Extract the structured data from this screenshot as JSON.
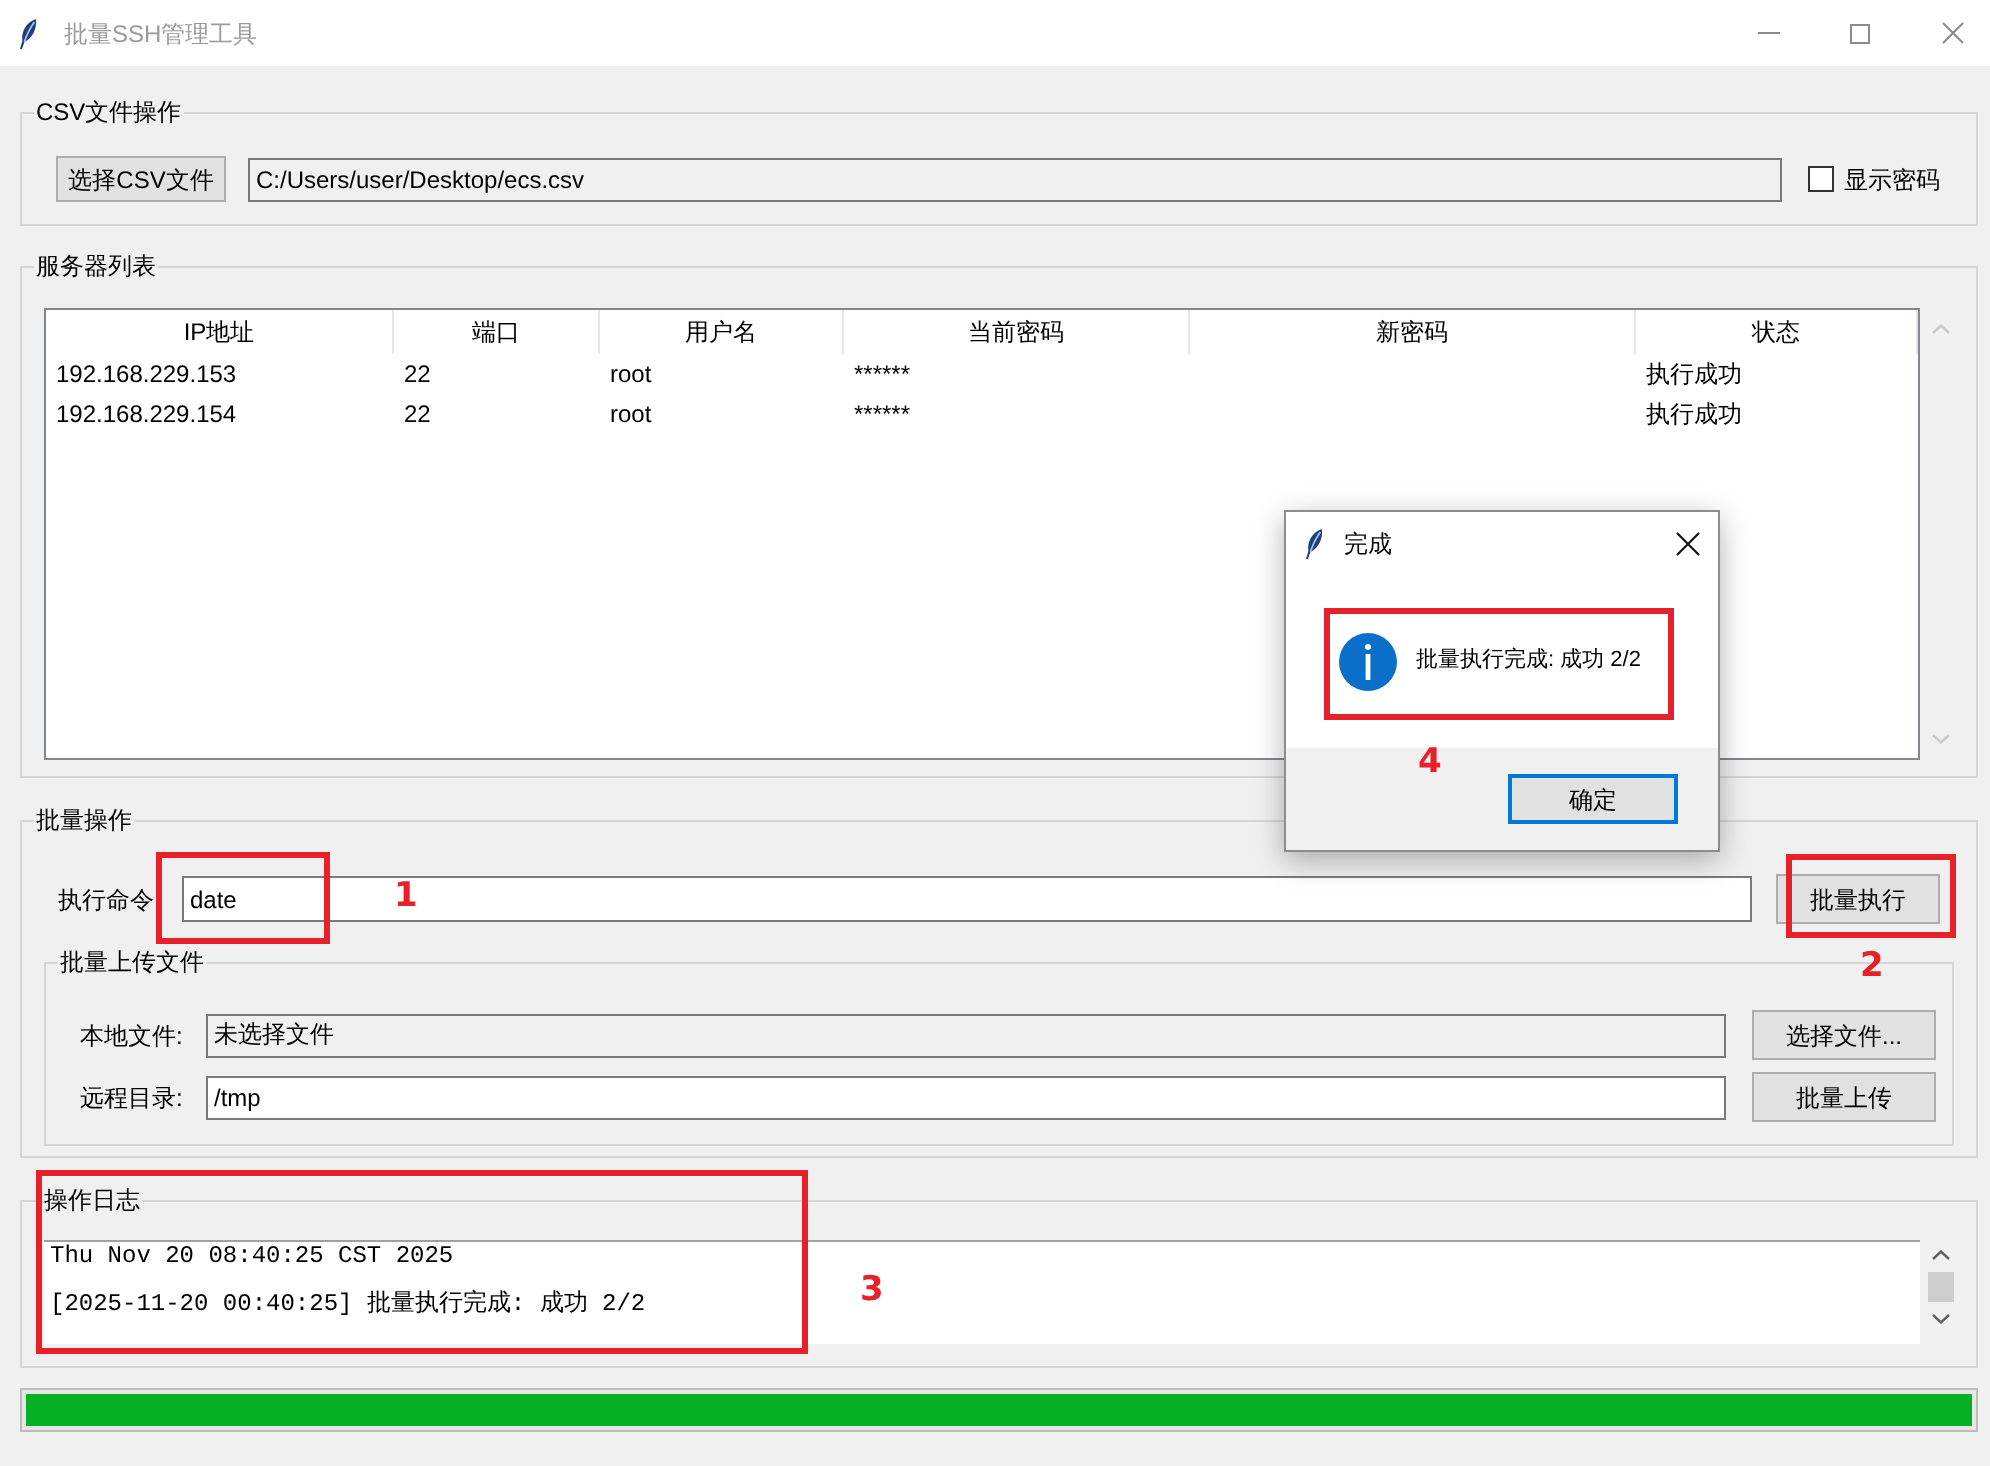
{
  "window": {
    "title": "批量SSH管理工具"
  },
  "csv_group": {
    "title": "CSV文件操作",
    "select_button": "选择CSV文件",
    "path_field": {
      "value": "C:/Users/user/Desktop/ecs.csv",
      "readonly": true
    },
    "show_password": {
      "label": "显示密码",
      "checked": false
    }
  },
  "server_list": {
    "title": "服务器列表",
    "columns": [
      "IP地址",
      "端口",
      "用户名",
      "当前密码",
      "新密码",
      "状态"
    ],
    "rows": [
      {
        "ip": "192.168.229.153",
        "port": "22",
        "username": "root",
        "current_password": "******",
        "status": "执行成功"
      },
      {
        "ip": "192.168.229.154",
        "port": "22",
        "username": "root",
        "current_password": "******",
        "status": "执行成功"
      }
    ]
  },
  "batch_ops": {
    "title": "批量操作",
    "command": {
      "label": "执行命令",
      "value": "date",
      "readonly": false
    },
    "execute_button": "批量执行",
    "upload": {
      "title": "批量上传文件",
      "local_file": {
        "label": "本地文件:",
        "value": "未选择文件",
        "readonly": true
      },
      "choose_button": "选择文件...",
      "remote_dir": {
        "label": "远程目录:",
        "value": "/tmp",
        "readonly": false
      },
      "upload_button": "批量上传"
    }
  },
  "log": {
    "title": "操作日志",
    "lines": [
      "Thu Nov 20 08:40:25 CST 2025",
      "[2025-11-20 00:40:25] 批量执行完成: 成功 2/2"
    ]
  },
  "progress": {
    "level": 1
  },
  "dialog": {
    "title": "完成",
    "message": "批量执行完成: 成功 2/2",
    "ok_button": {
      "label": "确定",
      "focused": true
    }
  },
  "annotations": [
    {
      "label": "1"
    },
    {
      "label": "2"
    },
    {
      "label": "3"
    },
    {
      "label": "4"
    }
  ]
}
